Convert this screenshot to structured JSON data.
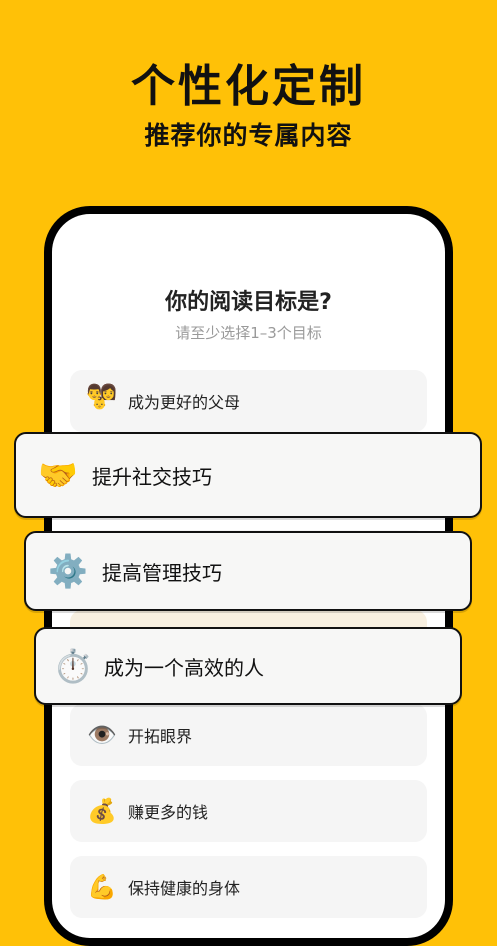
{
  "headline": {
    "title": "个性化定制",
    "subtitle": "推荐你的专属内容"
  },
  "question": {
    "title": "你的阅读目标是?",
    "hint": "请至少选择1–3个目标"
  },
  "options": [
    {
      "label": "成为更好的父母",
      "icon": "family-icon"
    },
    {
      "label": "开拓眼界",
      "icon": "eye-icon"
    },
    {
      "label": "赚更多的钱",
      "icon": "money-bag-icon"
    },
    {
      "label": "保持健康的身体",
      "icon": "muscle-icon"
    }
  ],
  "highlighted": [
    {
      "label": "提升社交技巧",
      "icon": "handshake-icon"
    },
    {
      "label": "提高管理技巧",
      "icon": "gear-icon"
    },
    {
      "label": "成为一个高效的人",
      "icon": "stopwatch-icon"
    }
  ],
  "colors": {
    "background": "#FFC107",
    "phone": "#000000",
    "card": "#F7F7F6"
  }
}
